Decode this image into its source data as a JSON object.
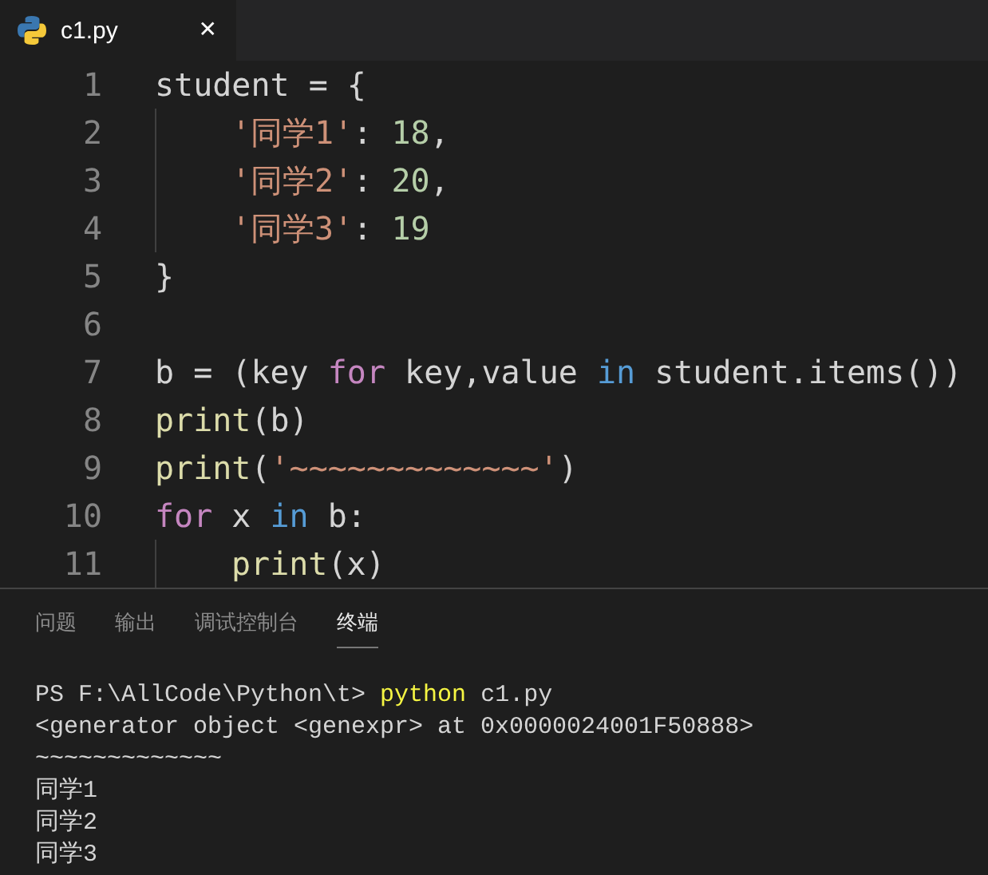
{
  "tabs": [
    {
      "label": "c1.py",
      "selected": true,
      "close": "✕"
    }
  ],
  "editor": {
    "lines": [
      {
        "number": "1",
        "indent": false,
        "tokens": [
          {
            "kind": "plain",
            "text": "student = {"
          }
        ]
      },
      {
        "number": "2",
        "indent": true,
        "tokens": [
          {
            "kind": "string",
            "text": "'同学1'"
          },
          {
            "kind": "plain",
            "text": ": "
          },
          {
            "kind": "number",
            "text": "18"
          },
          {
            "kind": "plain",
            "text": ","
          }
        ]
      },
      {
        "number": "3",
        "indent": true,
        "tokens": [
          {
            "kind": "string",
            "text": "'同学2'"
          },
          {
            "kind": "plain",
            "text": ": "
          },
          {
            "kind": "number",
            "text": "20"
          },
          {
            "kind": "plain",
            "text": ","
          }
        ]
      },
      {
        "number": "4",
        "indent": true,
        "tokens": [
          {
            "kind": "string",
            "text": "'同学3'"
          },
          {
            "kind": "plain",
            "text": ": "
          },
          {
            "kind": "number",
            "text": "19"
          }
        ]
      },
      {
        "number": "5",
        "indent": false,
        "tokens": [
          {
            "kind": "plain",
            "text": "}"
          }
        ]
      },
      {
        "number": "6",
        "indent": false
      },
      {
        "number": "7",
        "indent": false,
        "tokens": [
          {
            "kind": "plain",
            "text": "b = (key "
          },
          {
            "kind": "control",
            "text": "for"
          },
          {
            "kind": "plain",
            "text": " key,value "
          },
          {
            "kind": "keyword",
            "text": "in"
          },
          {
            "kind": "plain",
            "text": " student.items())"
          }
        ]
      },
      {
        "number": "8",
        "indent": false,
        "tokens": [
          {
            "kind": "function",
            "text": "print"
          },
          {
            "kind": "plain",
            "text": "(b)"
          }
        ]
      },
      {
        "number": "9",
        "indent": false,
        "tokens": [
          {
            "kind": "function",
            "text": "print"
          },
          {
            "kind": "plain",
            "text": "("
          },
          {
            "kind": "string",
            "text": "'~~~~~~~~~~~~~'"
          },
          {
            "kind": "plain",
            "text": ")"
          }
        ]
      },
      {
        "number": "10",
        "indent": false,
        "tokens": [
          {
            "kind": "control",
            "text": "for"
          },
          {
            "kind": "plain",
            "text": " x "
          },
          {
            "kind": "keyword",
            "text": "in"
          },
          {
            "kind": "plain",
            "text": " b:"
          }
        ]
      },
      {
        "number": "11",
        "indent": true,
        "tokens": [
          {
            "kind": "function",
            "text": "print"
          },
          {
            "kind": "plain",
            "text": "(x)"
          }
        ]
      }
    ]
  },
  "panel_tabs": [
    {
      "label": "问题",
      "selected": false
    },
    {
      "label": "输出",
      "selected": false
    },
    {
      "label": "调试控制台",
      "selected": false
    },
    {
      "label": "终端",
      "selected": true
    }
  ],
  "terminal": {
    "lines": [
      {
        "tokens": [
          {
            "kind": "plain",
            "text": "PS F:\\AllCode\\Python\\t> "
          },
          {
            "kind": "command",
            "text": "python"
          },
          {
            "kind": "plain",
            "text": " c1.py"
          }
        ]
      },
      {
        "tokens": [
          {
            "kind": "plain",
            "text": "<generator object <genexpr> at 0x0000024001F50888>"
          }
        ]
      },
      {
        "tokens": [
          {
            "kind": "plain",
            "text": "~~~~~~~~~~~~~"
          }
        ]
      },
      {
        "tokens": [
          {
            "kind": "plain",
            "text": "同学1"
          }
        ]
      },
      {
        "tokens": [
          {
            "kind": "plain",
            "text": "同学2"
          }
        ]
      },
      {
        "tokens": [
          {
            "kind": "plain",
            "text": "同学3"
          }
        ]
      }
    ]
  }
}
